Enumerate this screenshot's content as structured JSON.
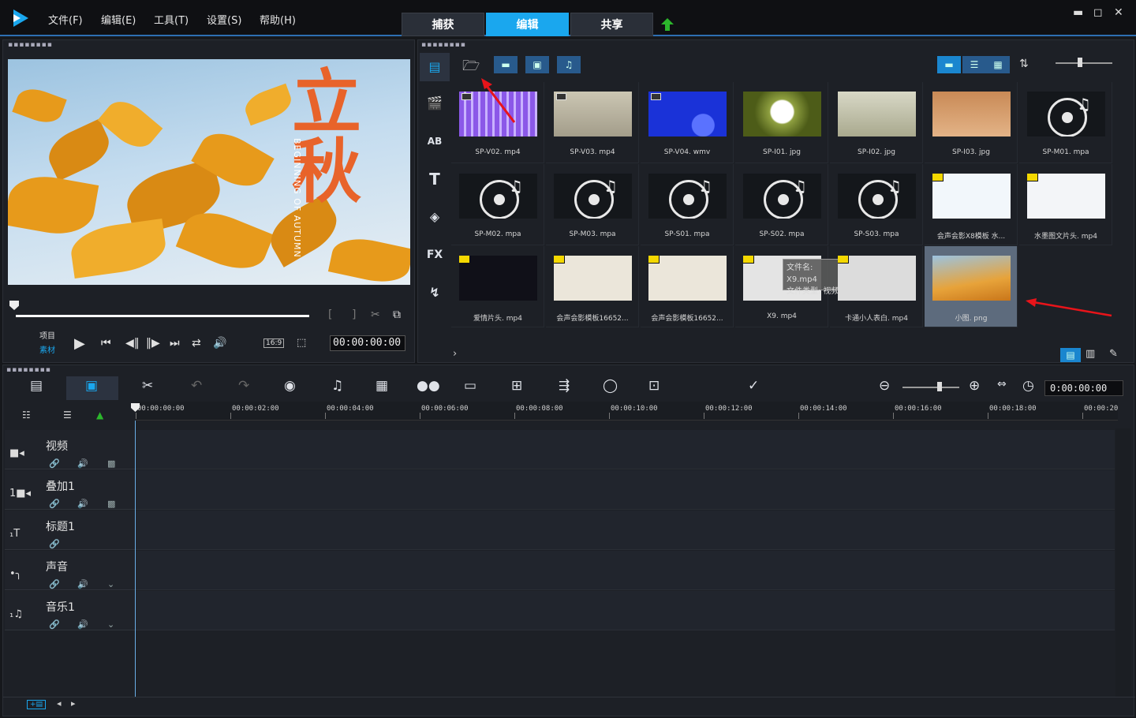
{
  "menu": [
    "文件(F)",
    "编辑(E)",
    "工具(T)",
    "设置(S)",
    "帮助(H)"
  ],
  "tabs": [
    {
      "label": "捕获",
      "active": false
    },
    {
      "label": "编辑",
      "active": true
    },
    {
      "label": "共享",
      "active": false
    }
  ],
  "window": {
    "min": "▬",
    "max": "◻",
    "close": "✕"
  },
  "preview": {
    "title_text": "立秋",
    "subtitle_text": "BEGINNING OF AUTUMN",
    "mode_project": "项目",
    "mode_clip": "素材",
    "aspect": "16:9",
    "timecode": "00:00:00:00"
  },
  "library": {
    "items": [
      {
        "name": "SP-V02. mp4",
        "kind": "video-film"
      },
      {
        "name": "SP-V03. mp4",
        "kind": "video-film"
      },
      {
        "name": "SP-V04. wmv",
        "kind": "video-film"
      },
      {
        "name": "SP-I01. jpg",
        "kind": "image"
      },
      {
        "name": "SP-I02. jpg",
        "kind": "image"
      },
      {
        "name": "SP-I03. jpg",
        "kind": "image"
      },
      {
        "name": "SP-M01. mpa",
        "kind": "audio"
      },
      {
        "name": "SP-M02. mpa",
        "kind": "audio"
      },
      {
        "name": "SP-M03. mpa",
        "kind": "audio"
      },
      {
        "name": "SP-S01. mpa",
        "kind": "audio"
      },
      {
        "name": "SP-S02. mpa",
        "kind": "audio"
      },
      {
        "name": "SP-S03. mpa",
        "kind": "audio"
      },
      {
        "name": "会声会影X8模板 水...",
        "kind": "video"
      },
      {
        "name": "水墨图文片头. mp4",
        "kind": "video"
      },
      {
        "name": "爱情片头. mp4",
        "kind": "video"
      },
      {
        "name": "会声会影模板16652...",
        "kind": "video"
      },
      {
        "name": "会声会影模板16652...",
        "kind": "video"
      },
      {
        "name": "X9. mp4",
        "kind": "video"
      },
      {
        "name": "卡通小人表白. mp4",
        "kind": "video"
      },
      {
        "name": "小图. png",
        "kind": "image-selected"
      }
    ],
    "tooltip_line1": "文件名: X9.mp4",
    "tooltip_line2": "文件类型: 视频"
  },
  "timeline": {
    "timecode": "0:00:00:00",
    "ruler": [
      "00:00:00:00",
      "00:00:02:00",
      "00:00:04:00",
      "00:00:06:00",
      "00:00:08:00",
      "00:00:10:00",
      "00:00:12:00",
      "00:00:14:00",
      "00:00:16:00",
      "00:00:18:00",
      "00:00:20"
    ],
    "tracks": [
      {
        "name": "视频",
        "icon": "video-camera-icon"
      },
      {
        "name": "叠加1",
        "icon": "overlay-camera-icon"
      },
      {
        "name": "标题1",
        "icon": "title-icon"
      },
      {
        "name": "声音",
        "icon": "voice-icon"
      },
      {
        "name": "音乐1",
        "icon": "music-icon"
      }
    ]
  },
  "colors": {
    "accent": "#1aa7ee",
    "arrow": "#e8141a",
    "upload": "#2cb72c"
  }
}
